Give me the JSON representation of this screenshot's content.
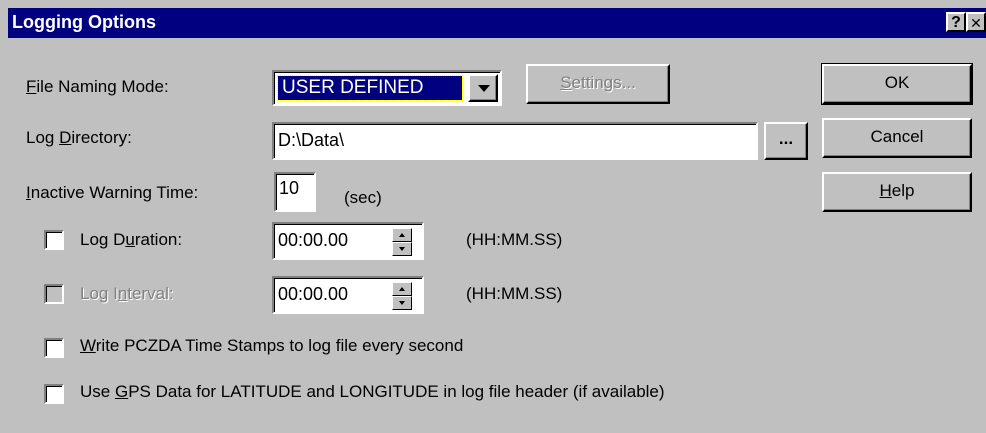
{
  "window": {
    "title": "Logging Options",
    "help_glyph": "?",
    "close_glyph": "✕"
  },
  "file_naming": {
    "label_pre": "",
    "label_mn": "F",
    "label_post": "ile Naming Mode:",
    "value": "USER DEFINED",
    "settings_pre": "",
    "settings_mn": "S",
    "settings_post": "ettings..."
  },
  "log_directory": {
    "label_pre": "Log ",
    "label_mn": "D",
    "label_post": "irectory:",
    "value": "D:\\Data\\",
    "browse_label": "..."
  },
  "inactive_warning": {
    "label_pre": "",
    "label_mn": "I",
    "label_post": "nactive Warning Time:",
    "value": "10",
    "unit": "(sec)"
  },
  "log_duration": {
    "label_pre": "Log D",
    "label_mn": "u",
    "label_post": "ration:",
    "value": "00:00.00",
    "format": "(HH:MM.SS)",
    "checked": false
  },
  "log_interval": {
    "label_pre": "Log I",
    "label_mn": "n",
    "label_post": "terval:",
    "value": "00:00.00",
    "format": "(HH:MM.SS)",
    "checked": false,
    "enabled": false
  },
  "pczda": {
    "label_pre": "",
    "label_mn": "W",
    "label_post": "rite PCZDA Time Stamps to log file every second",
    "checked": false
  },
  "gps": {
    "label_pre": "Use ",
    "label_mn": "G",
    "label_post": "PS Data for LATITUDE and LONGITUDE in log file header (if available)",
    "checked": false
  },
  "buttons": {
    "ok": "OK",
    "cancel": "Cancel",
    "help_pre": "",
    "help_mn": "H",
    "help_post": "elp"
  },
  "colors": {
    "face": "#c0c0c0",
    "titlebar": "#000080",
    "selection": "#000080"
  }
}
